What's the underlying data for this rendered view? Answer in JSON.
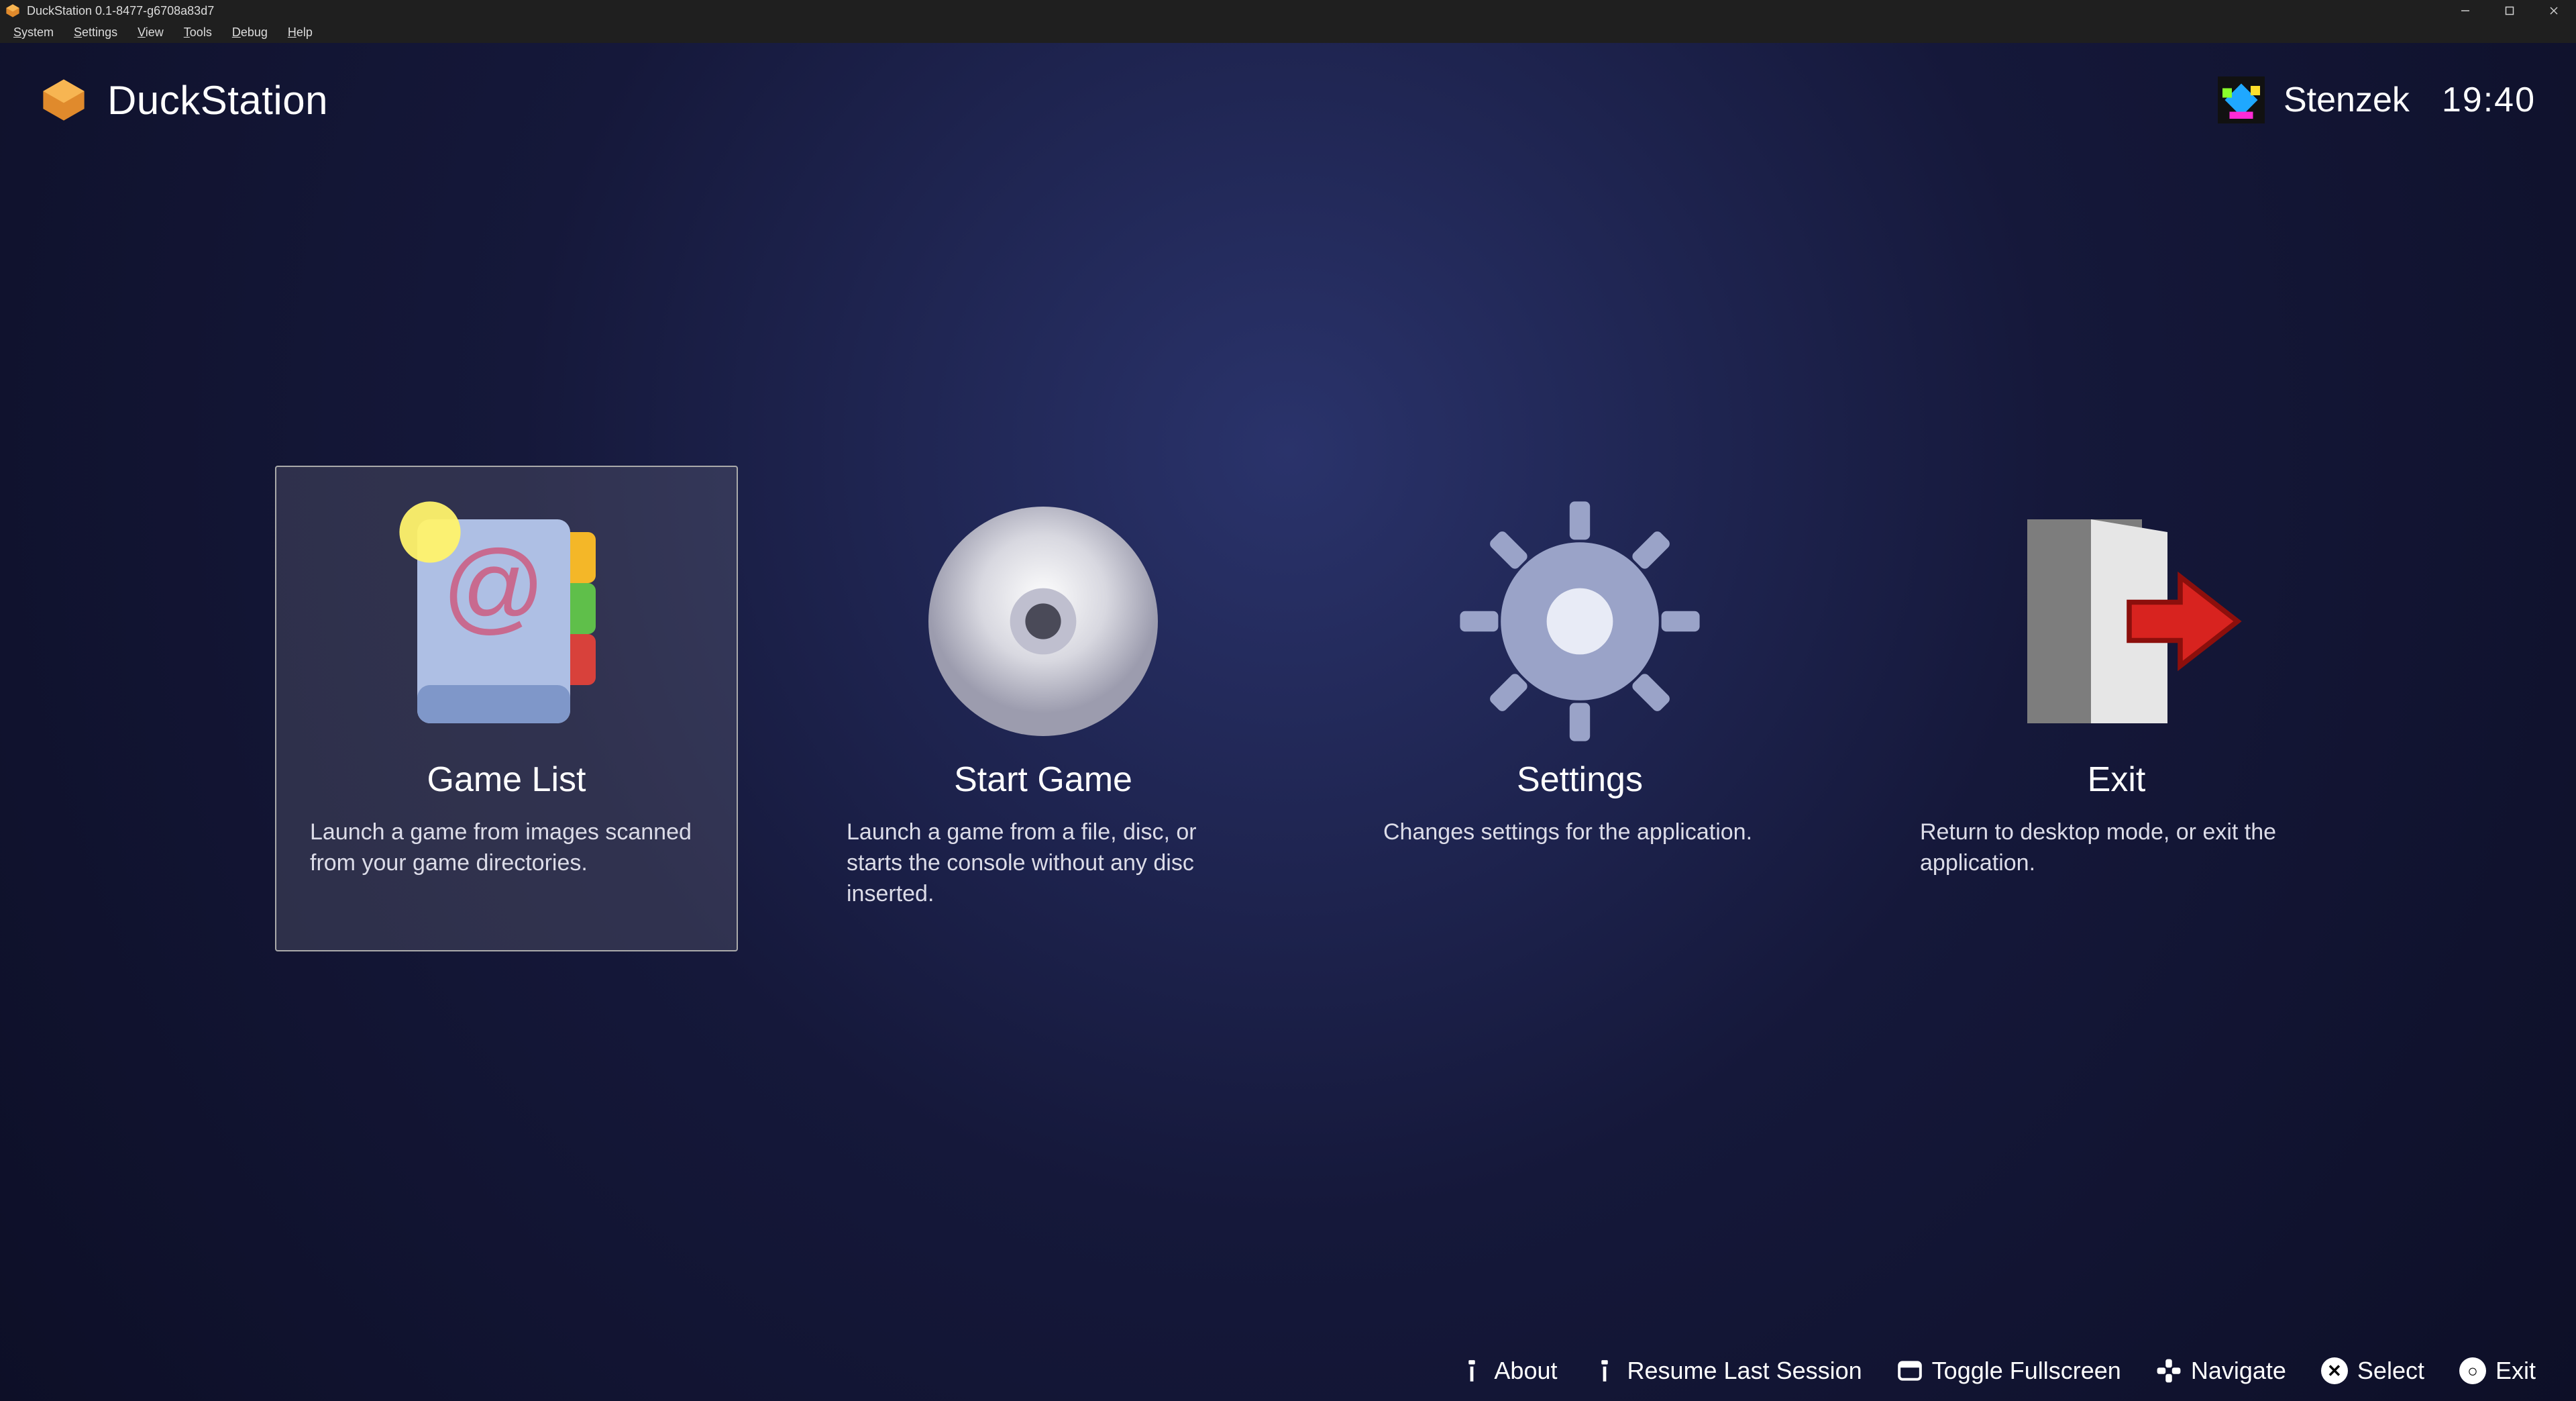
{
  "window": {
    "title": "DuckStation 0.1-8477-g6708a83d7"
  },
  "menubar": [
    {
      "accel": "S",
      "rest": "ystem"
    },
    {
      "accel": "S",
      "rest": "ettings"
    },
    {
      "accel": "V",
      "rest": "iew"
    },
    {
      "accel": "T",
      "rest": "ools"
    },
    {
      "accel": "D",
      "rest": "ebug"
    },
    {
      "accel": "H",
      "rest": "elp"
    }
  ],
  "header": {
    "brand": "DuckStation",
    "user": "Stenzek",
    "clock": "19:40"
  },
  "tiles": [
    {
      "id": "game-list",
      "title": "Game List",
      "desc": "Launch a game from images scanned from your game directories.",
      "selected": true
    },
    {
      "id": "start-game",
      "title": "Start Game",
      "desc": "Launch a game from a file, disc, or starts the console without any disc inserted.",
      "selected": false
    },
    {
      "id": "settings",
      "title": "Settings",
      "desc": "Changes settings for the application.",
      "selected": false
    },
    {
      "id": "exit",
      "title": "Exit",
      "desc": "Return to desktop mode, or exit the application.",
      "selected": false
    }
  ],
  "footer": [
    {
      "icon": "menu",
      "label": "About"
    },
    {
      "icon": "menu",
      "label": "Resume Last Session"
    },
    {
      "icon": "window",
      "label": "Toggle Fullscreen"
    },
    {
      "icon": "dpad",
      "label": "Navigate"
    },
    {
      "icon": "cross",
      "label": "Select"
    },
    {
      "icon": "circle",
      "label": "Exit"
    }
  ]
}
